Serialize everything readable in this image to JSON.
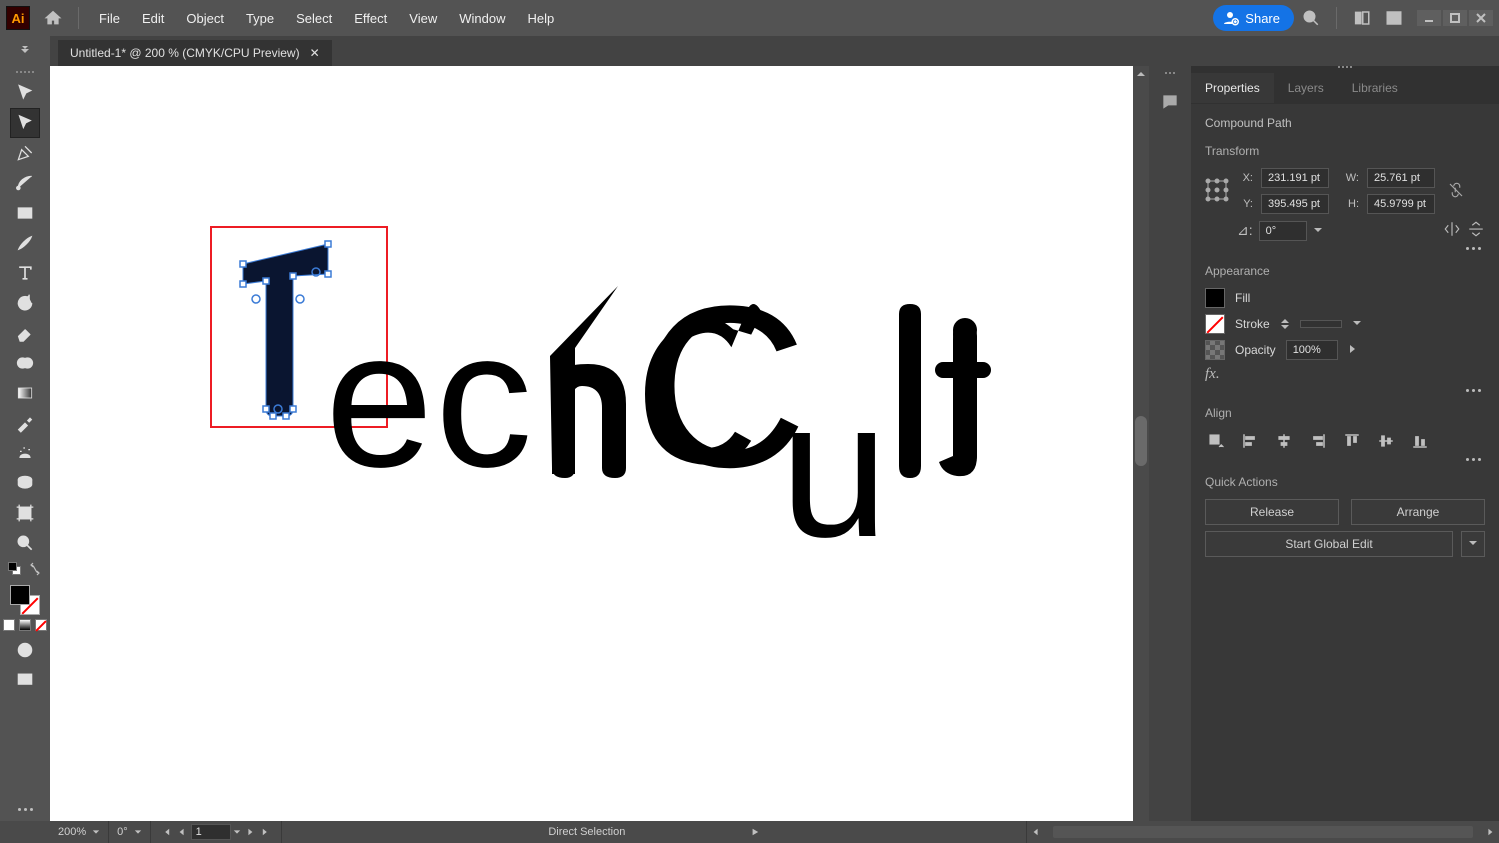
{
  "menubar": {
    "logo_text": "Ai",
    "items": [
      "File",
      "Edit",
      "Object",
      "Type",
      "Select",
      "Effect",
      "View",
      "Window",
      "Help"
    ],
    "share_label": "Share"
  },
  "document": {
    "tab_title": "Untitled-1* @ 200 % (CMYK/CPU Preview)",
    "canvas_text": "echCult"
  },
  "statusbar": {
    "zoom": "200%",
    "rotation": "0°",
    "page": "1",
    "tool_hint": "Direct Selection"
  },
  "panels": {
    "tabs": [
      "Properties",
      "Layers",
      "Libraries"
    ],
    "object_type": "Compound Path",
    "transform": {
      "title": "Transform",
      "x_label": "X:",
      "x": "231.191 pt",
      "y_label": "Y:",
      "y": "395.495 pt",
      "w_label": "W:",
      "w": "25.761 pt",
      "h_label": "H:",
      "h": "45.9799 pt",
      "angle_label": "⊿:",
      "angle": "0°"
    },
    "appearance": {
      "title": "Appearance",
      "fill_label": "Fill",
      "stroke_label": "Stroke",
      "opacity_label": "Opacity",
      "opacity_value": "100%",
      "fx_label": "fx."
    },
    "align": {
      "title": "Align"
    },
    "quick_actions": {
      "title": "Quick Actions",
      "release": "Release",
      "arrange": "Arrange",
      "global_edit": "Start Global Edit"
    }
  }
}
